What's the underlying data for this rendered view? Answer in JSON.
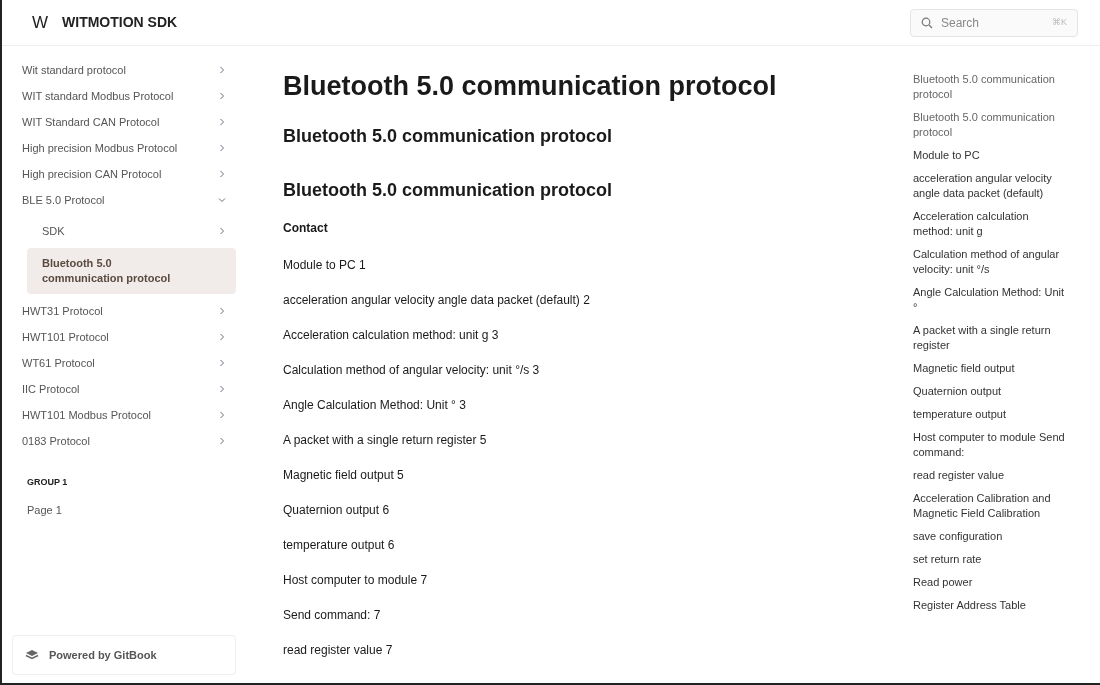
{
  "header": {
    "logo_letter": "W",
    "site_title": "WITMOTION SDK",
    "search": {
      "placeholder": "Search",
      "shortcut": "⌘K"
    }
  },
  "sidebar": {
    "items": [
      {
        "label": "Wit standard protocol",
        "expanded": false,
        "selected": false
      },
      {
        "label": "WIT standard Modbus Protocol",
        "expanded": false,
        "selected": false
      },
      {
        "label": "WIT Standard CAN Protocol",
        "expanded": false,
        "selected": false
      },
      {
        "label": "High precision Modbus Protocol",
        "expanded": false,
        "selected": false
      },
      {
        "label": "High precision CAN Protocol",
        "expanded": false,
        "selected": false
      },
      {
        "label": "BLE 5.0 Protocol",
        "expanded": true,
        "selected": false,
        "children": [
          {
            "label": "SDK",
            "expanded": false,
            "selected": false
          },
          {
            "label": "Bluetooth 5.0 communication protocol",
            "selected": true
          }
        ]
      },
      {
        "label": "HWT31 Protocol",
        "expanded": false,
        "selected": false
      },
      {
        "label": "HWT101 Protocol",
        "expanded": false,
        "selected": false
      },
      {
        "label": "WT61 Protocol",
        "expanded": false,
        "selected": false
      },
      {
        "label": "IIC Protocol",
        "expanded": false,
        "selected": false
      },
      {
        "label": "HWT101 Modbus Protocol",
        "expanded": false,
        "selected": false
      },
      {
        "label": "0183 Protocol",
        "expanded": false,
        "selected": false
      }
    ],
    "group": {
      "title": "GROUP 1",
      "items": [
        {
          "label": "Page 1",
          "selected": false
        }
      ]
    },
    "footer": "Powered by GitBook"
  },
  "content": {
    "title": "Bluetooth 5.0 communication protocol",
    "headings": [
      "Bluetooth 5.0 communication protocol",
      "Bluetooth 5.0 communication protocol"
    ],
    "toc_heading": "Contact",
    "toc_lines": [
      "Module to PC 1",
      "acceleration angular velocity angle data packet (default) 2",
      "Acceleration calculation method: unit g 3",
      "Calculation method of angular velocity: unit °/s 3",
      "Angle Calculation Method: Unit ° 3",
      "A packet with a single return register 5",
      "Magnetic field output 5",
      "Quaternion output 6",
      "temperature output 6",
      "Host computer to module 7",
      "Send command: 7",
      "read register value 7"
    ]
  },
  "outline": [
    "Bluetooth 5.0 communication protocol",
    "Bluetooth 5.0 communication protocol",
    "Module to PC",
    "acceleration angular velocity angle data packet (default)",
    "Acceleration calculation method: unit g",
    "Calculation method of angular velocity: unit °/s",
    "Angle Calculation Method: Unit °",
    "A packet with a single return register",
    "Magnetic field output",
    "Quaternion output",
    "temperature output",
    "Host computer to module Send command:",
    "read register value",
    "Acceleration Calibration and Magnetic Field Calibration",
    "save configuration",
    "set return rate",
    "Read power",
    "Register Address Table"
  ]
}
